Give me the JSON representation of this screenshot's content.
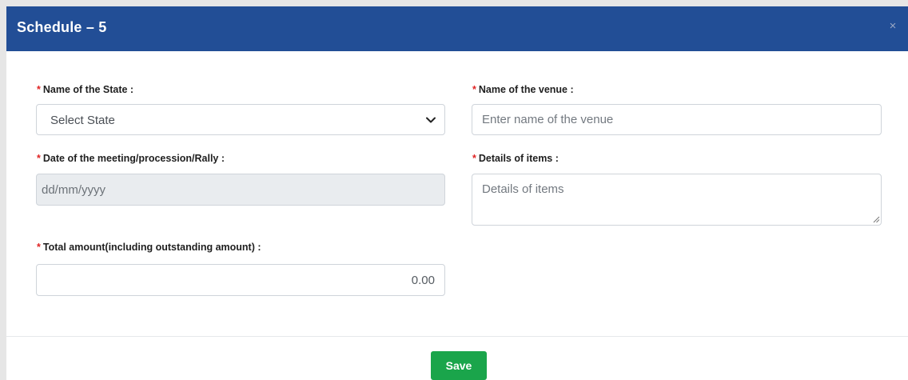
{
  "modal": {
    "title": "Schedule – 5",
    "close_symbol": "×"
  },
  "form": {
    "required_marker": "*",
    "state": {
      "label": "Name of the State :",
      "selected": "Select State",
      "icon": "chevron-down-icon"
    },
    "venue": {
      "label": "Name of the venue :",
      "placeholder": "Enter name of the venue"
    },
    "date": {
      "label": "Date of the meeting/procession/Rally :",
      "placeholder": "dd/mm/yyyy"
    },
    "items": {
      "label": "Details of items :",
      "placeholder": "Details of items"
    },
    "amount": {
      "label": "Total amount(including outstanding amount) :",
      "value": "0.00"
    }
  },
  "footer": {
    "save_label": "Save"
  },
  "colors": {
    "header_bg": "#224e96",
    "required": "#e02424",
    "save_bg": "#1aa54b",
    "disabled_bg": "#e9ecef"
  }
}
